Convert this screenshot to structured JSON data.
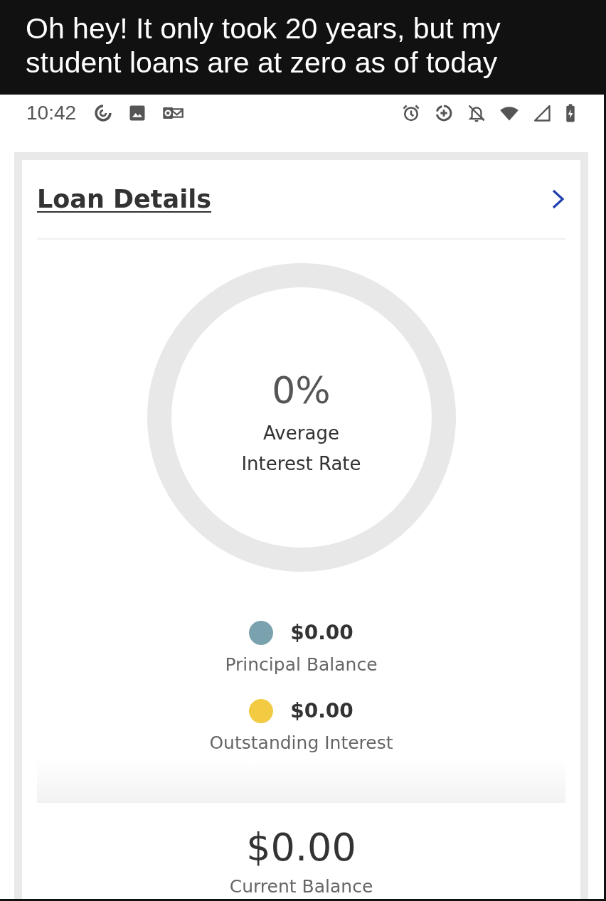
{
  "caption": {
    "text": "Oh hey! It only took 20 years, but my student loans are at zero as of today"
  },
  "status_bar": {
    "time": "10:42"
  },
  "loan_card": {
    "title": "Loan Details",
    "donut": {
      "value": "0%",
      "label": "Average Interest Rate"
    },
    "legend": [
      {
        "amount": "$0.00",
        "label": "Principal Balance",
        "color": "#7aa2ae"
      },
      {
        "amount": "$0.00",
        "label": "Outstanding Interest",
        "color": "#f2cb43"
      }
    ],
    "current_balance": {
      "amount": "$0.00",
      "label": "Current Balance"
    }
  }
}
